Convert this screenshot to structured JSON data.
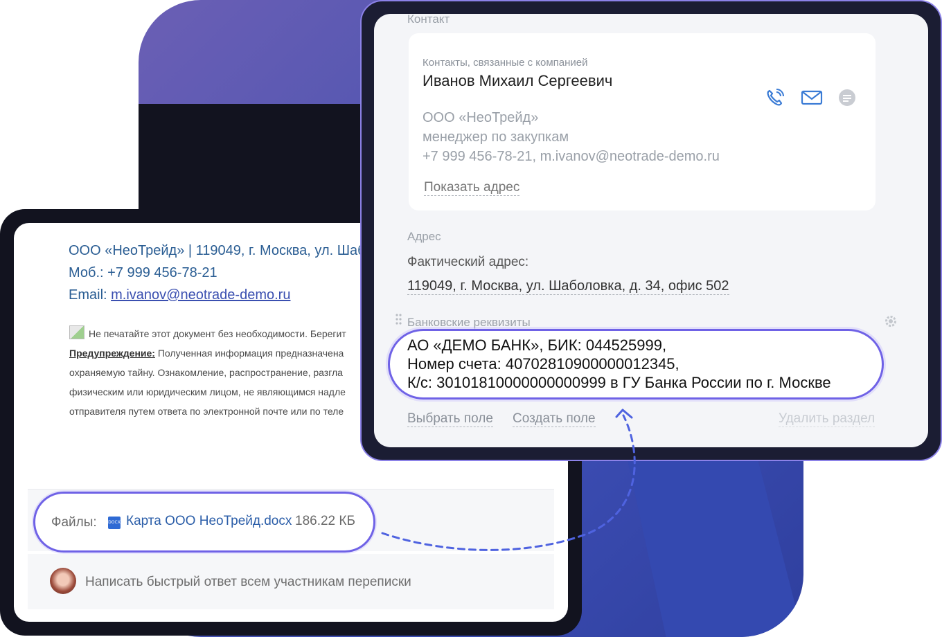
{
  "email": {
    "signature_line1": "ООО «НеоТрейд» | 119049, г. Москва, ул. Шаб",
    "signature_line2": "Моб.: +7 999 456-78-21",
    "email_label": "Email: ",
    "email_value": "m.ivanov@neotrade-demo.ru",
    "disclaimer_line1": "Не печатайте этот документ без необходимости. Берегит",
    "warning_label": "Предупреждение:",
    "disclaimer_line2": " Полученная информация предназначена",
    "disclaimer_line3": "охраняемую тайну.  Ознакомление, распространение, разгла",
    "disclaimer_line4": "физическим или юридическим лицом, не являющимся надле",
    "disclaimer_line5": "отправителя путем ответа по электронной почте или по теле",
    "files_label": "Файлы:",
    "file_icon_text": "DOCX",
    "file_name": "Карта ООО НеоТрейд.docx",
    "file_size": "186.22 КБ",
    "reply_placeholder": "Написать быстрый ответ всем участникам переписки"
  },
  "crm": {
    "contact_section": "Контакт",
    "contact_related": "Контакты, связанные с компанией",
    "contact_name": "Иванов Михаил Сергеевич",
    "contact_org": "ООО «НеоТрейд»",
    "contact_position": "менеджер по закупкам",
    "contact_info": "+7 999 456-78-21, m.ivanov@neotrade-demo.ru",
    "show_address": "Показать адрес",
    "address_section": "Адрес",
    "fact_address_label": "Фактический адрес:",
    "fact_address_value": "119049, г. Москва, ул. Шаболовка, д. 34, офис 502",
    "bank_section": "Банковские реквизиты",
    "bank_line1": "АО «ДЕМО БАНК», БИК: 044525999,",
    "bank_line2": "Номер счета: 40702810900000012345,",
    "bank_line3": "К/с: 30101810000000000999 в ГУ Банка России по г. Москве",
    "select_field": "Выбрать поле",
    "create_field": "Создать поле",
    "delete_section": "Удалить раздел"
  },
  "icons": {
    "phone": "phone-icon",
    "mail": "mail-icon",
    "chat": "chat-icon",
    "gear": "gear-icon",
    "drag": "drag-handle-icon"
  },
  "colors": {
    "highlight_border": "#6f62e6",
    "link_blue": "#2a5d93",
    "icon_blue": "#3a7bd5"
  }
}
